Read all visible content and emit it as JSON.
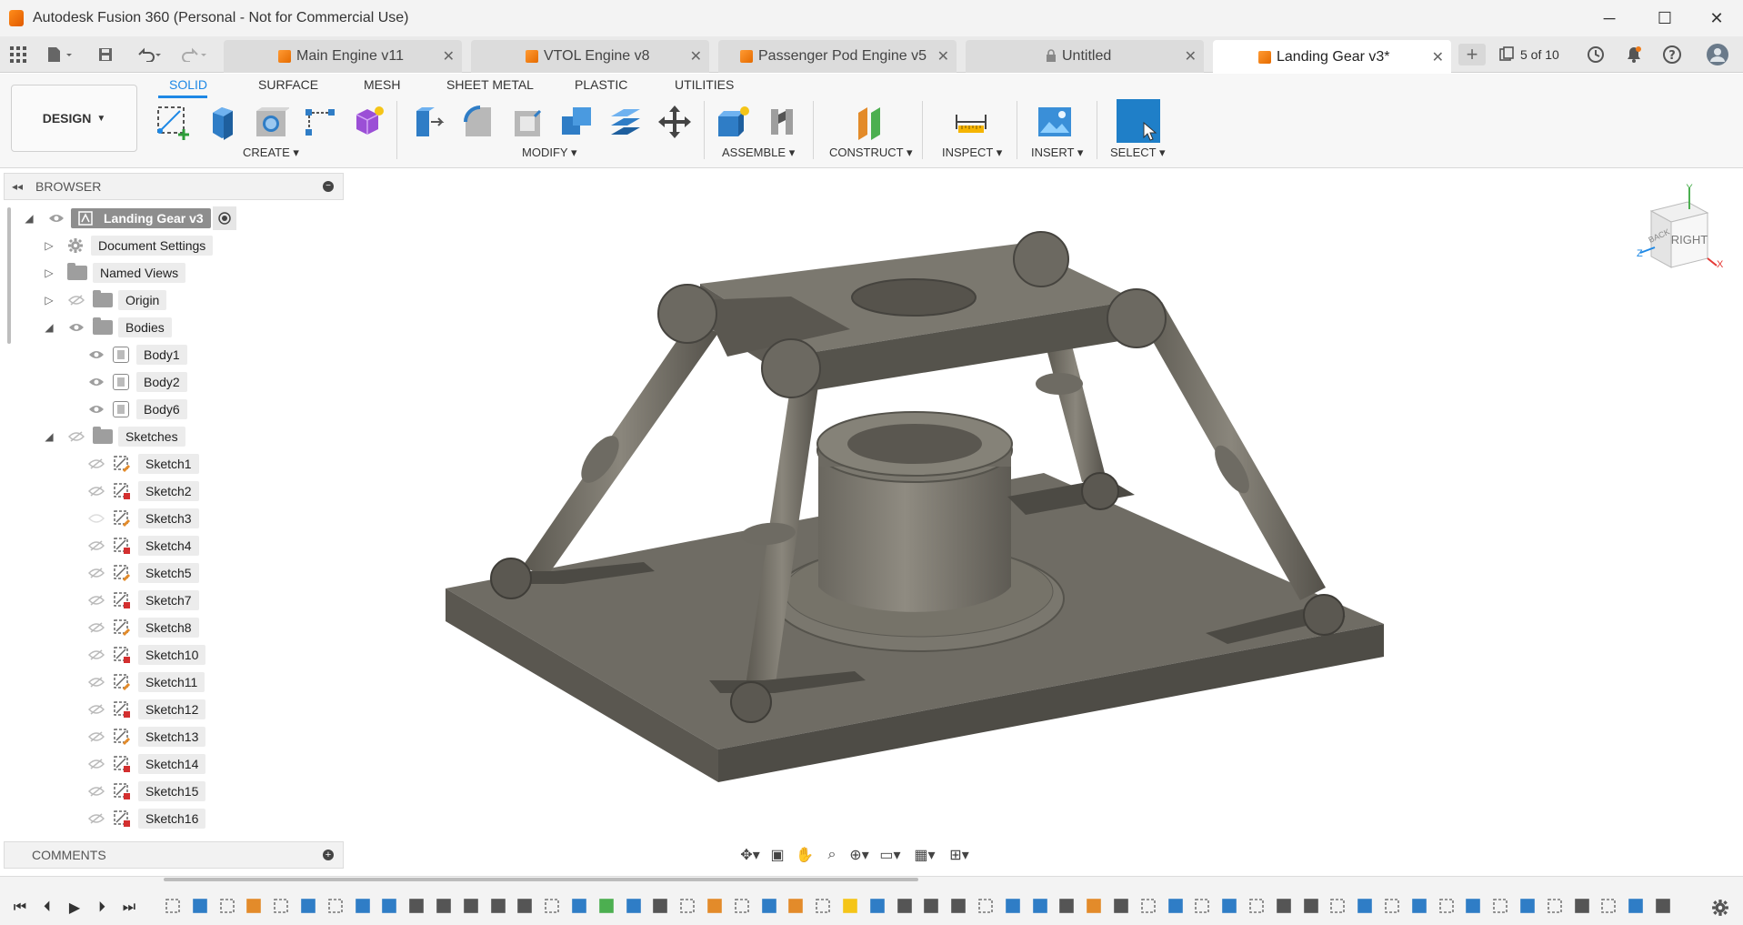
{
  "window": {
    "title": "Autodesk Fusion 360 (Personal - Not for Commercial Use)",
    "controls": {
      "minimize": "─",
      "maximize": "☐",
      "close": "✕"
    }
  },
  "tabs": [
    {
      "label": "Main Engine v11",
      "icon": "part-icon",
      "active": false
    },
    {
      "label": "VTOL Engine v8",
      "icon": "part-icon",
      "active": false
    },
    {
      "label": "Passenger Pod Engine v5",
      "icon": "part-icon",
      "active": false
    },
    {
      "label": "Untitled",
      "icon": "lock-icon",
      "active": false
    },
    {
      "label": "Landing Gear v3*",
      "icon": "part-icon",
      "active": true
    }
  ],
  "tab_counter": "5 of 10",
  "toolbar": {
    "workspace": "DESIGN",
    "workspace_tabs": [
      "SOLID",
      "SURFACE",
      "MESH",
      "SHEET METAL",
      "PLASTIC",
      "UTILITIES"
    ],
    "active_workspace_tab": "SOLID",
    "groups": {
      "create": "CREATE",
      "modify": "MODIFY",
      "assemble": "ASSEMBLE",
      "construct": "CONSTRUCT",
      "inspect": "INSPECT",
      "insert": "INSERT",
      "select": "SELECT"
    }
  },
  "browser": {
    "title": "BROWSER",
    "root": "Landing Gear v3",
    "items": [
      {
        "label": "Document Settings",
        "type": "settings"
      },
      {
        "label": "Named Views",
        "type": "folder"
      },
      {
        "label": "Origin",
        "type": "folder"
      },
      {
        "label": "Bodies",
        "type": "folder"
      }
    ],
    "bodies": [
      "Body1",
      "Body2",
      "Body6"
    ],
    "sketches_label": "Sketches",
    "sketches": [
      "Sketch1",
      "Sketch2",
      "Sketch3",
      "Sketch4",
      "Sketch5",
      "Sketch7",
      "Sketch8",
      "Sketch10",
      "Sketch11",
      "Sketch12",
      "Sketch13",
      "Sketch14",
      "Sketch15",
      "Sketch16"
    ]
  },
  "comments": {
    "title": "COMMENTS"
  },
  "viewcube": {
    "face_label": "RIGHT",
    "axes": [
      "X",
      "Y",
      "Z"
    ]
  },
  "colors": {
    "accent": "#1e88e5",
    "brand_orange": "#f07c1a",
    "model_gray": "#6f6c64",
    "select_blue": "#1f7fc8"
  }
}
